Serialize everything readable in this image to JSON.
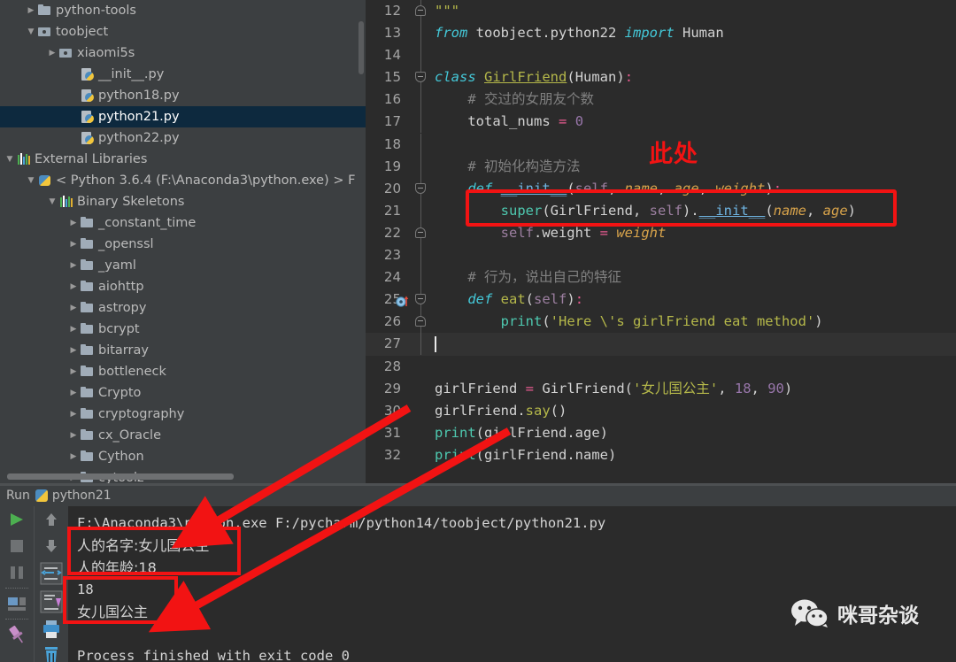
{
  "project_tree": {
    "items": [
      {
        "label": "python-tools",
        "indent": 1,
        "twisty": "collapsed",
        "icon": "folder-icon",
        "selected": false
      },
      {
        "label": "toobject",
        "indent": 1,
        "twisty": "expanded",
        "icon": "source-folder-icon",
        "selected": false
      },
      {
        "label": "xiaomi5s",
        "indent": 2,
        "twisty": "collapsed",
        "icon": "source-folder-icon",
        "selected": false
      },
      {
        "label": "__init__.py",
        "indent": 3,
        "twisty": "none",
        "icon": "python-file-icon",
        "selected": false
      },
      {
        "label": "python18.py",
        "indent": 3,
        "twisty": "none",
        "icon": "python-file-icon",
        "selected": false
      },
      {
        "label": "python21.py",
        "indent": 3,
        "twisty": "none",
        "icon": "python-file-icon",
        "selected": true
      },
      {
        "label": "python22.py",
        "indent": 3,
        "twisty": "none",
        "icon": "python-file-icon",
        "selected": false
      },
      {
        "label": "External Libraries",
        "indent": 0,
        "twisty": "expanded",
        "icon": "libraries-icon",
        "selected": false
      },
      {
        "label": "< Python 3.6.4 (F:\\Anaconda3\\python.exe) >  F",
        "indent": 1,
        "twisty": "expanded",
        "icon": "python-interpreter-icon",
        "selected": false
      },
      {
        "label": "Binary Skeletons",
        "indent": 2,
        "twisty": "expanded",
        "icon": "libraries-icon",
        "selected": false
      },
      {
        "label": "_constant_time",
        "indent": 3,
        "twisty": "collapsed",
        "icon": "folder-icon",
        "selected": false
      },
      {
        "label": "_openssl",
        "indent": 3,
        "twisty": "collapsed",
        "icon": "folder-icon",
        "selected": false
      },
      {
        "label": "_yaml",
        "indent": 3,
        "twisty": "collapsed",
        "icon": "folder-icon",
        "selected": false
      },
      {
        "label": "aiohttp",
        "indent": 3,
        "twisty": "collapsed",
        "icon": "folder-icon",
        "selected": false
      },
      {
        "label": "astropy",
        "indent": 3,
        "twisty": "collapsed",
        "icon": "folder-icon",
        "selected": false
      },
      {
        "label": "bcrypt",
        "indent": 3,
        "twisty": "collapsed",
        "icon": "folder-icon",
        "selected": false
      },
      {
        "label": "bitarray",
        "indent": 3,
        "twisty": "collapsed",
        "icon": "folder-icon",
        "selected": false
      },
      {
        "label": "bottleneck",
        "indent": 3,
        "twisty": "collapsed",
        "icon": "folder-icon",
        "selected": false
      },
      {
        "label": "Crypto",
        "indent": 3,
        "twisty": "collapsed",
        "icon": "folder-icon",
        "selected": false
      },
      {
        "label": "cryptography",
        "indent": 3,
        "twisty": "collapsed",
        "icon": "folder-icon",
        "selected": false
      },
      {
        "label": "cx_Oracle",
        "indent": 3,
        "twisty": "collapsed",
        "icon": "folder-icon",
        "selected": false
      },
      {
        "label": "Cython",
        "indent": 3,
        "twisty": "collapsed",
        "icon": "folder-icon",
        "selected": false
      },
      {
        "label": "cytoolz",
        "indent": 3,
        "twisty": "collapsed",
        "icon": "folder-icon",
        "selected": false
      }
    ]
  },
  "editor": {
    "current_line": 27,
    "lines": [
      {
        "n": 12,
        "text": "\"\"\""
      },
      {
        "n": 13,
        "text": "from toobject.python22 import Human"
      },
      {
        "n": 14,
        "text": ""
      },
      {
        "n": 15,
        "text": "class GirlFriend(Human):"
      },
      {
        "n": 16,
        "text": "    # 交过的女朋友个数"
      },
      {
        "n": 17,
        "text": "    total_nums = 0"
      },
      {
        "n": 18,
        "text": ""
      },
      {
        "n": 19,
        "text": "    # 初始化构造方法"
      },
      {
        "n": 20,
        "text": "    def __init__(self, name, age, weight):"
      },
      {
        "n": 21,
        "text": "        super(GirlFriend, self).__init__(name, age)"
      },
      {
        "n": 22,
        "text": "        self.weight = weight"
      },
      {
        "n": 23,
        "text": ""
      },
      {
        "n": 24,
        "text": "    # 行为，说出自己的特征"
      },
      {
        "n": 25,
        "text": "    def eat(self):"
      },
      {
        "n": 26,
        "text": "        print('Here \\'s girlFriend eat method')"
      },
      {
        "n": 27,
        "text": ""
      },
      {
        "n": 28,
        "text": ""
      },
      {
        "n": 29,
        "text": "girlFriend = GirlFriend('女儿国公主', 18, 90)"
      },
      {
        "n": 30,
        "text": "girlFriend.say()"
      },
      {
        "n": 31,
        "text": "print(girlFriend.age)"
      },
      {
        "n": 32,
        "text": "print(girlFriend.name)"
      }
    ]
  },
  "annotations": {
    "cichu_label": "此处",
    "box_color": "#f21313"
  },
  "run_panel": {
    "title": "Run",
    "config_name": "python21",
    "toolbar_left": [
      {
        "name": "run-button",
        "glyph": "▶"
      },
      {
        "name": "stop-button",
        "glyph": "■"
      },
      {
        "name": "pause-button",
        "glyph": "▮▮"
      },
      {
        "name": "restore-layout-button",
        "glyph": "▤"
      },
      {
        "name": "pin-tab-button",
        "glyph": "📌"
      }
    ],
    "toolbar_mid": [
      {
        "name": "up-stacktrace-button",
        "glyph": "↑"
      },
      {
        "name": "down-stacktrace-button",
        "glyph": "↓"
      },
      {
        "name": "soft-wrap-button",
        "glyph": "⇄"
      },
      {
        "name": "scroll-to-end-button",
        "glyph": "⇩"
      },
      {
        "name": "print-button",
        "glyph": "🖶"
      },
      {
        "name": "clear-all-button",
        "glyph": "🗑"
      }
    ],
    "console": [
      {
        "text": "F:\\Anaconda3\\python.exe F:/pycharm/python14/toobject/python21.py",
        "cn": false
      },
      {
        "text": "人的名字:女儿国公主",
        "cn": true
      },
      {
        "text": "人的年龄:18",
        "cn": true
      },
      {
        "text": "18",
        "cn": false
      },
      {
        "text": "女儿国公主",
        "cn": true
      },
      {
        "text": "",
        "cn": false
      },
      {
        "text": "Process finished with exit code 0",
        "cn": false
      }
    ]
  },
  "watermark": {
    "label": "咪哥杂谈",
    "icon": "wechat-icon"
  }
}
